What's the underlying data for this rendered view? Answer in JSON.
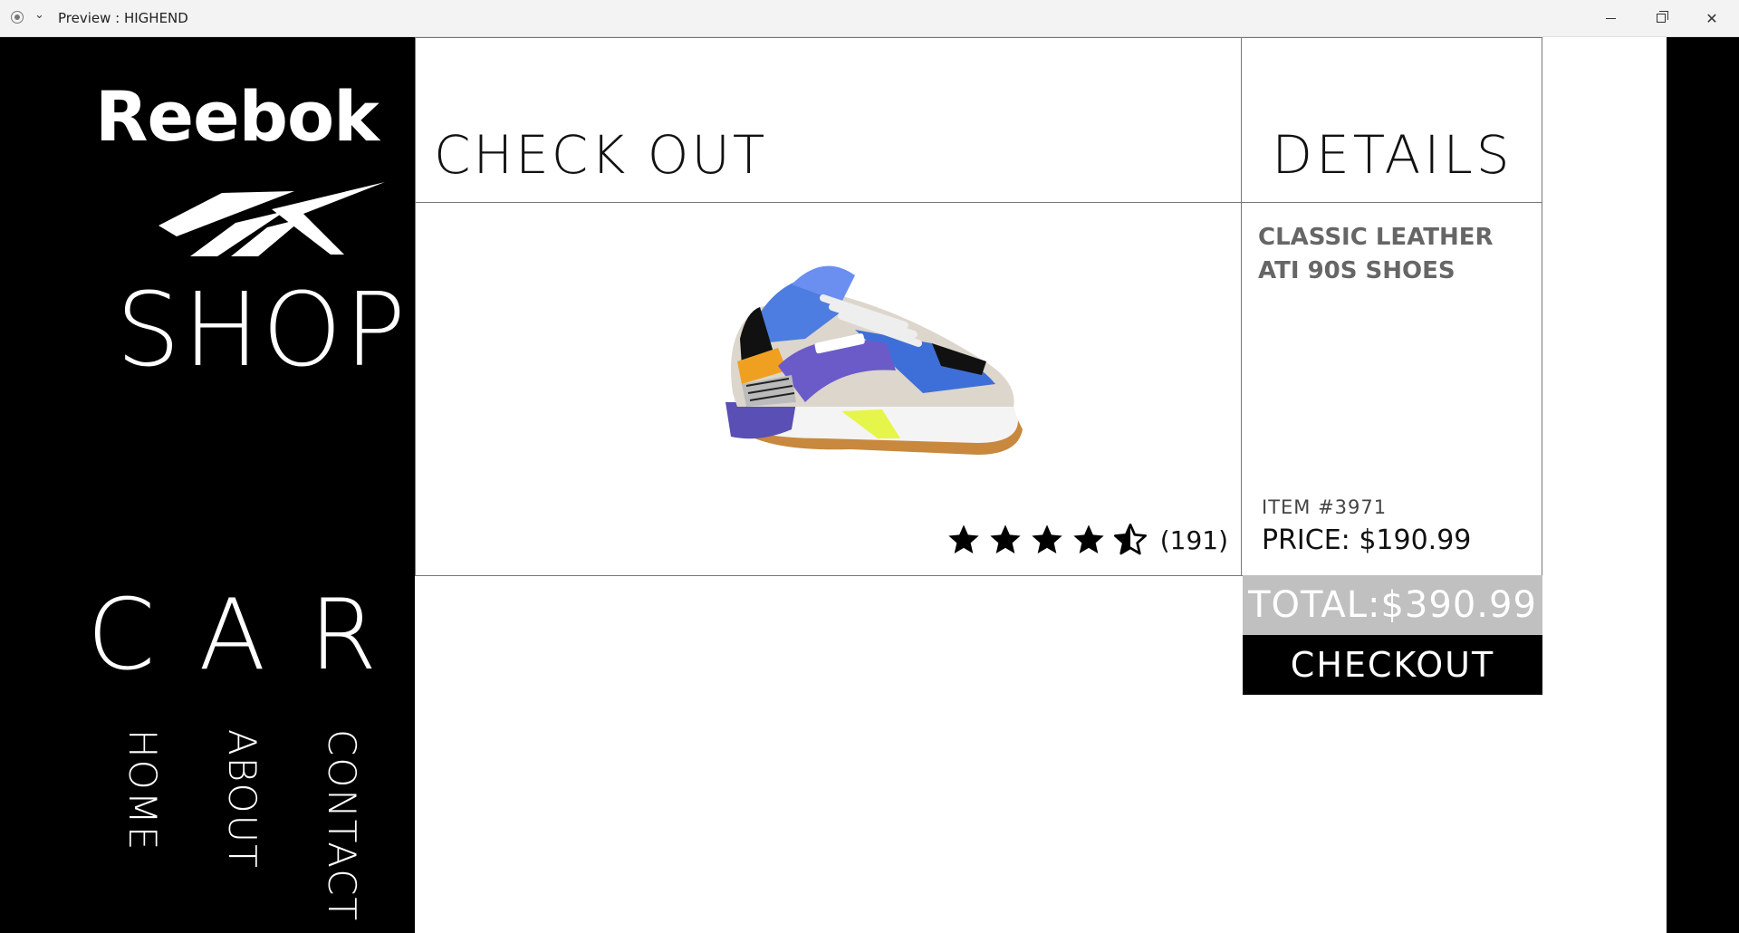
{
  "window": {
    "title": "Preview : HIGHEND"
  },
  "sidebar": {
    "logo_text": "Reebok",
    "shop_label": "SHOP",
    "cart_label": "CART",
    "nav": [
      "HOME",
      "ABOUT",
      "CONTACT"
    ]
  },
  "checkout": {
    "title": "CHECK OUT",
    "details_title": "DETAILS",
    "product": {
      "name": "CLASSIC LEATHER ATI 90S SHOES",
      "item_number": "ITEM #3971",
      "price": "PRICE: $190.99",
      "rating": 4.5,
      "reviews": "(191)"
    },
    "total": "TOTAL:$390.99",
    "checkout_label": "CHECKOUT"
  },
  "colors": {
    "sidebar_bg": "#000000",
    "total_bg": "#c0c0c0",
    "checkout_bg": "#000000",
    "product_name": "#666666"
  }
}
